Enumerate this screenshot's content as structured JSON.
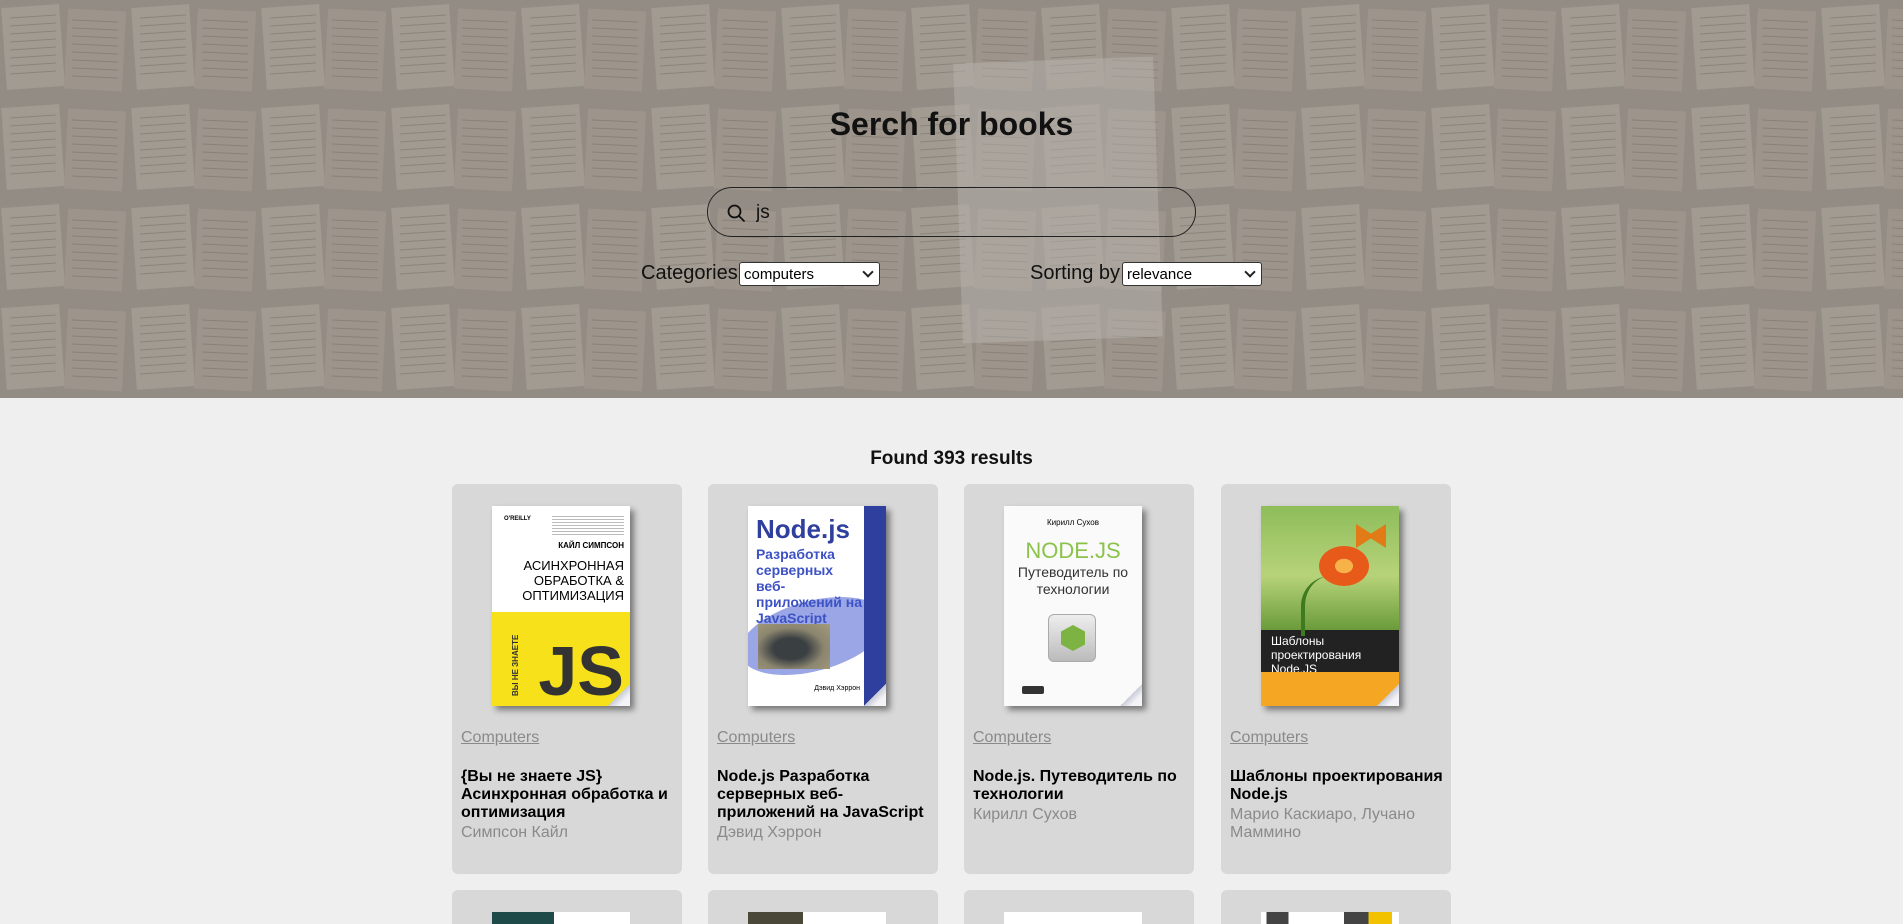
{
  "hero": {
    "title": "Serch for books",
    "search": {
      "value": "js"
    },
    "categories": {
      "label": "Categories",
      "selected": "computers"
    },
    "sorting": {
      "label": "Sorting by",
      "selected": "relevance"
    }
  },
  "results": {
    "count_text": "Found 393 results",
    "books": [
      {
        "category": "Computers",
        "title": "{Вы не знаете JS} Асинхронная обработка и оптимизация",
        "author": "Симпсон Кайл",
        "cover": {
          "publisher": "O'REILLY",
          "author": "КАЙЛ СИМПСОН",
          "title": "АСИНХРОННАЯ ОБРАБОТКА & ОПТИМИЗАЦИЯ",
          "big": "JS",
          "side": "ВЫ НЕ ЗНАЕТЕ"
        }
      },
      {
        "category": "Computers",
        "title": "Node.js Разработка серверных веб-приложений на JavaScript",
        "author": "Дэвид Хэррон",
        "cover": {
          "name": "Node.js",
          "subtitle": "Разработка серверных веб-приложений на JavaScript",
          "author": "Дэвид Хэррон"
        }
      },
      {
        "category": "Computers",
        "title": "Node.js. Путеводитель по технологии",
        "author": "Кирилл Сухов",
        "cover": {
          "author": "Кирилл Сухов",
          "name": "NODE.JS",
          "subtitle": "Путеводитель по технологии",
          "logo": "js"
        }
      },
      {
        "category": "Computers",
        "title": "Шаблоны проектирования Node.js",
        "author": "Марио Каскиаро, Лучано Маммино",
        "cover": {
          "title": "Шаблоны проектирования Node.JS"
        }
      }
    ]
  },
  "colors": {
    "page_bg": "#efefef",
    "card_bg": "#d8d8d8",
    "muted_text": "#8a8a8a"
  }
}
